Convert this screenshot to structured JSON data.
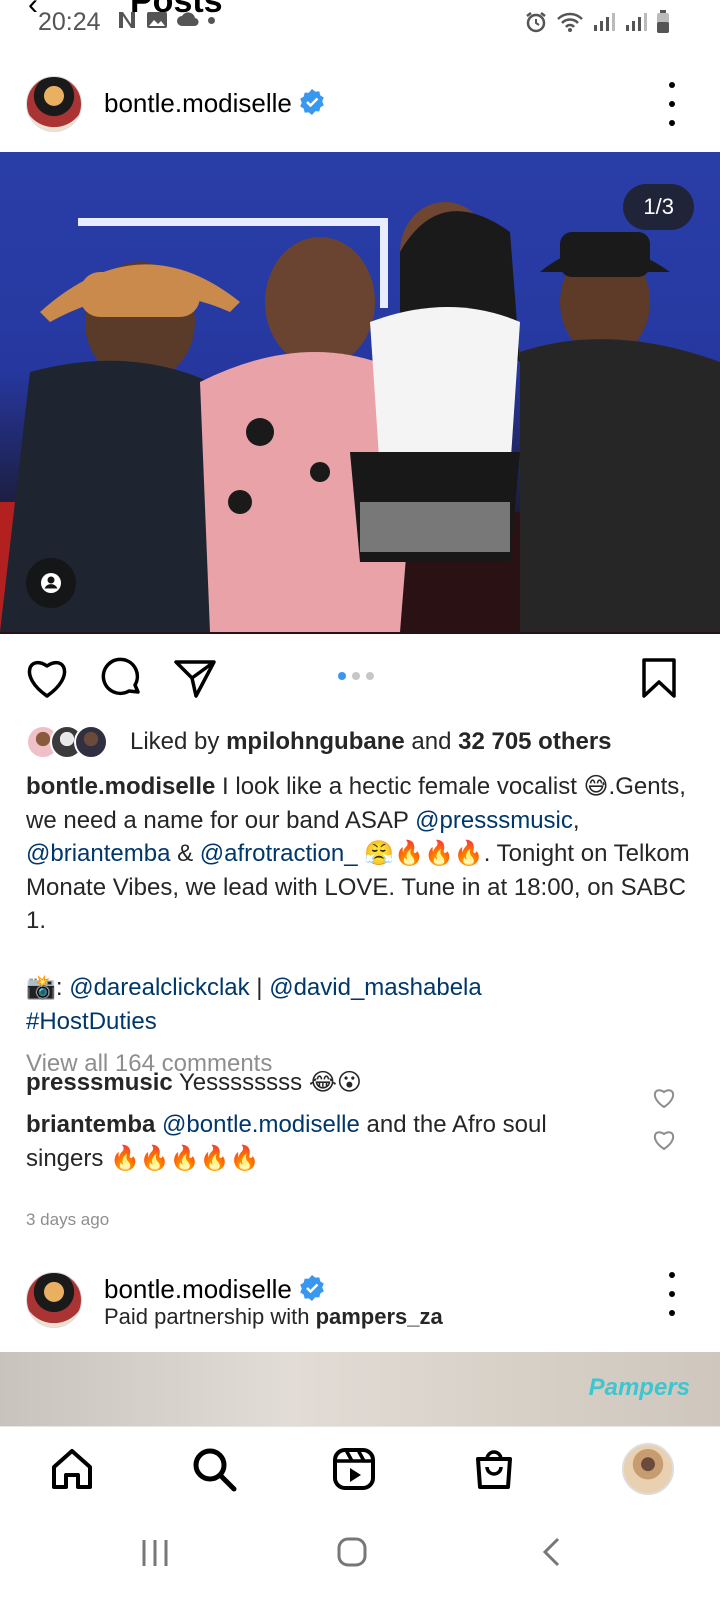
{
  "header": {
    "title": "Posts"
  },
  "status_bar": {
    "time": "20:24"
  },
  "post": {
    "username": "bontle.modiselle",
    "image_counter": "1/3",
    "carousel_total": 3,
    "carousel_active": 1,
    "likes": {
      "prefix": "Liked by ",
      "user": "mpilohngubane",
      "middle": " and ",
      "count": "32 705 others"
    },
    "caption": {
      "author": "bontle.modiselle",
      "t1": " I look like a hectic female vocalist 😅.Gents, we need a name for our band ASAP ",
      "m1": "@presssmusic",
      "t2": ", ",
      "m2": "@briantemba",
      "t3": " & ",
      "m3": "@afrotraction_",
      "t4": " 😤🔥🔥🔥. Tonight on Telkom Monate Vibes, we lead with LOVE. Tune in at 18:00, on SABC 1.",
      "t5": "📸: ",
      "m4": "@darealclickclak",
      "t6": " | ",
      "m5": "@david_mashabela",
      "hashtag": "#HostDuties"
    },
    "view_comments": "View all 164 comments",
    "comments": [
      {
        "user": "presssmusic",
        "text": " Yessssssss 😂😮"
      },
      {
        "user": "briantemba",
        "mention": "@bontle.modiselle",
        "text": " and the Afro soul singers 🔥🔥🔥🔥🔥"
      }
    ],
    "time_ago": "3 days ago"
  },
  "post2": {
    "username": "bontle.modiselle",
    "partner_prefix": "Paid partnership with ",
    "partner": "pampers_za",
    "logo_text": "Pampers"
  },
  "colors": {
    "link": "#00376b",
    "verified": "#3897f0",
    "dot_active": "#3897f0"
  }
}
